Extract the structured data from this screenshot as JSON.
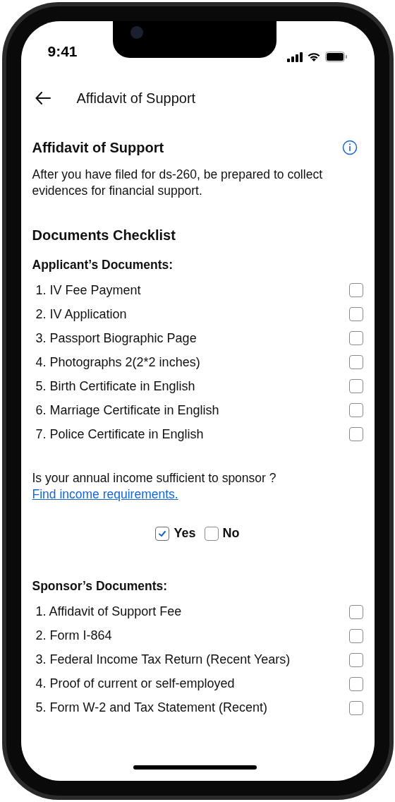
{
  "status_bar": {
    "time": "9:41"
  },
  "header": {
    "title": "Affidavit of Support"
  },
  "intro": {
    "title": "Affidavit of Support",
    "text": "After you have filed for ds-260, be prepared to collect evidences for financial support."
  },
  "checklist_title": "Documents Checklist",
  "applicant": {
    "title": "Applicant’s Documents:",
    "items": [
      {
        "label": "1. IV Fee Payment",
        "checked": false
      },
      {
        "label": "2. IV Application",
        "checked": false
      },
      {
        "label": "3. Passport Biographic Page",
        "checked": false
      },
      {
        "label": "4. Photographs 2(2*2 inches)",
        "checked": false
      },
      {
        "label": "5. Birth Certificate in English",
        "checked": false
      },
      {
        "label": "6. Marriage Certificate in English",
        "checked": false
      },
      {
        "label": "7. Police Certificate in English",
        "checked": false
      }
    ]
  },
  "income": {
    "question": "Is your annual income sufficient to sponsor ?",
    "link": "Find income requirements.",
    "options": [
      {
        "label": "Yes",
        "checked": true
      },
      {
        "label": "No",
        "checked": false
      }
    ]
  },
  "sponsor": {
    "title": "Sponsor’s Documents:",
    "items": [
      {
        "label": "1. Affidavit of Support Fee",
        "checked": false
      },
      {
        "label": "2. Form I-864",
        "checked": false
      },
      {
        "label": "3. Federal Income Tax Return (Recent Years)",
        "checked": false
      },
      {
        "label": "4. Proof of current or self-employed",
        "checked": false
      },
      {
        "label": "5. Form W-2 and Tax Statement (Recent)",
        "checked": false
      }
    ]
  }
}
